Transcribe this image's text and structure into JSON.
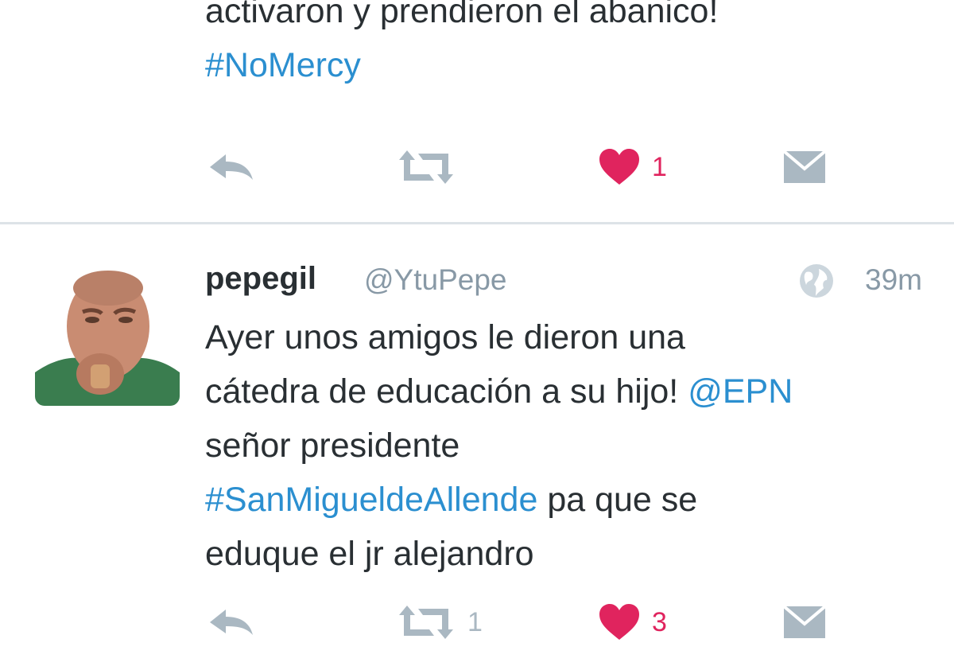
{
  "colors": {
    "link": "#2b8fd0",
    "text": "#292f33",
    "muted": "#8899a6",
    "icon": "#aab8c2",
    "like": "#e0245e"
  },
  "tweets": [
    {
      "text_line1": "activaron y prendieron el abanico!",
      "hashtag": "#NoMercy",
      "actions": {
        "reply_icon": "reply-icon",
        "retweet_icon": "retweet-icon",
        "retweet_count": "",
        "like_icon": "heart-icon",
        "like_count": "1",
        "liked": true,
        "dm_icon": "envelope-icon"
      }
    },
    {
      "display_name": "pepegil",
      "handle": "@YtuPepe",
      "visibility_icon": "globe-icon",
      "timestamp": "39m",
      "text_line1": "Ayer unos amigos le dieron una",
      "text_line2": "cátedra de educación a su hijo! ",
      "mention": "@EPN",
      "text_line3": "señor presidente",
      "hashtag": "#SanMigueldeAllende",
      "text_after_hashtag": " pa que se",
      "text_line5": "eduque el jr alejandro",
      "actions": {
        "reply_icon": "reply-icon",
        "retweet_icon": "retweet-icon",
        "retweet_count": "1",
        "like_icon": "heart-icon",
        "like_count": "3",
        "liked": true,
        "dm_icon": "envelope-icon"
      }
    }
  ]
}
